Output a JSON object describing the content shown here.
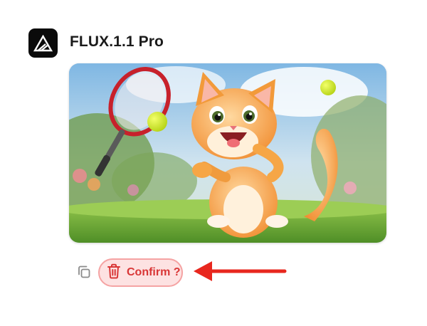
{
  "header": {
    "app_icon": "flux-logo-icon",
    "model_name": "FLUX.1.1 Pro"
  },
  "generated_image": {
    "icon": "generated-image"
  },
  "actions": {
    "copy_icon": "copy-icon",
    "confirm_icon": "trash-icon",
    "confirm_label": "Confirm ?",
    "confirm_color": "#d93636",
    "confirm_bg": "#fde2e2"
  },
  "annotation": {
    "arrow_color": "#e8271e"
  }
}
